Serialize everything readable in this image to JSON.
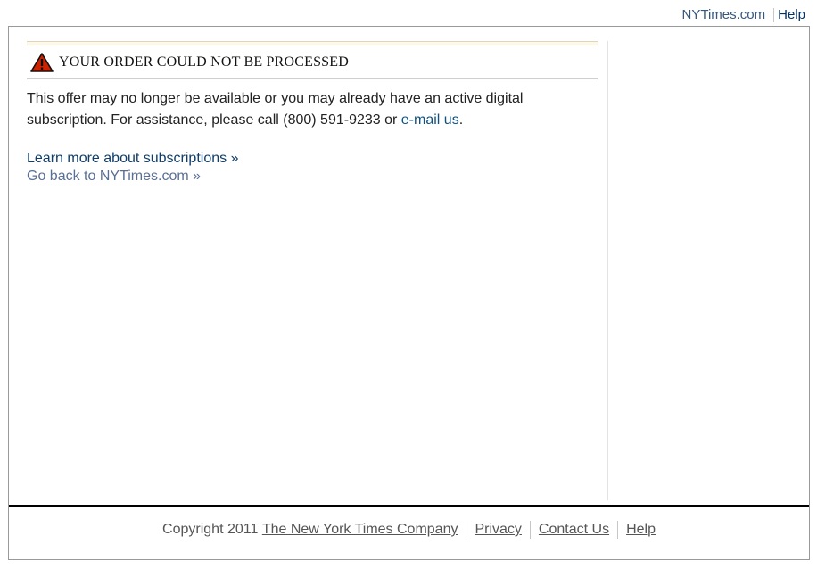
{
  "top_nav": {
    "site_link": "NYTimes.com",
    "help_link": "Help"
  },
  "alert": {
    "icon": "warning-triangle-icon",
    "title": "YOUR ORDER COULD NOT BE PROCESSED",
    "message_before": "This offer may no longer be available or you may already have an active digital subscription. For assistance, please call (800) 591-9233 or ",
    "email_link": "e-mail us",
    "message_after": "."
  },
  "links": {
    "learn_more": "Learn more about subscriptions »",
    "go_back": "Go back to NYTimes.com »"
  },
  "footer": {
    "copyright_text": "Copyright 2011",
    "company_link": "The New York Times Company",
    "privacy_link": "Privacy",
    "contact_link": "Contact Us",
    "help_link": "Help"
  },
  "colors": {
    "link_blue": "#11517d",
    "warning_red": "#cc2200",
    "rule_tan": "#e2d5b2"
  }
}
